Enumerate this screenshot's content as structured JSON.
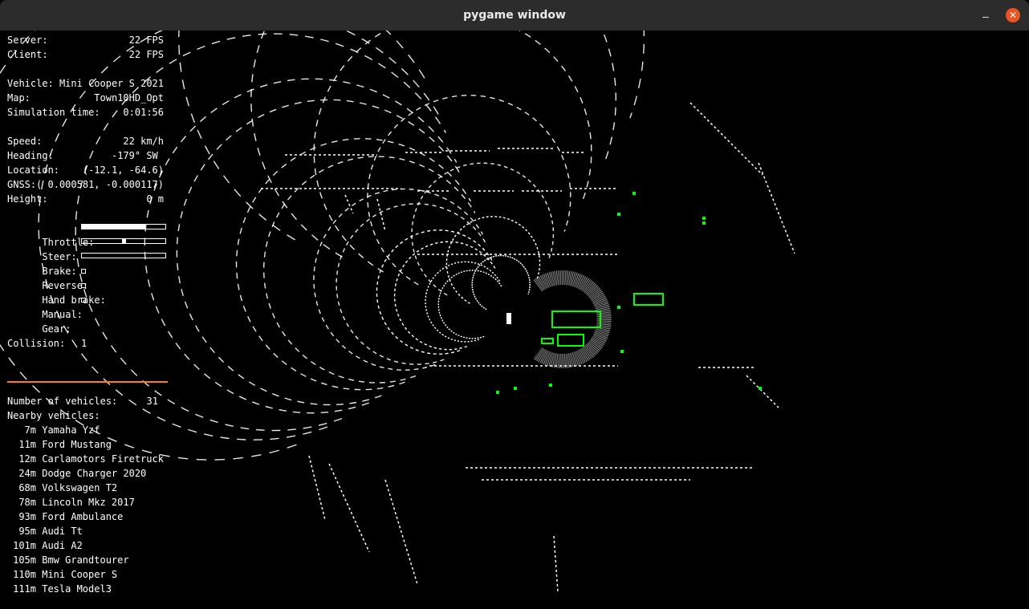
{
  "window": {
    "title": "pygame window",
    "controls": [
      "minimize-icon",
      "close-icon"
    ],
    "close_color": "#e95420"
  },
  "hud": {
    "server_label": "Server:",
    "server_value": "22 FPS",
    "client_label": "Client:",
    "client_value": "22 FPS",
    "vehicle_label": "Vehicle:",
    "vehicle_value": "Mini Cooper S 2021",
    "map_label": "Map:",
    "map_value": "Town10HD_Opt",
    "sim_time_label": "Simulation time:",
    "sim_time_value": "0:01:56",
    "speed_label": "Speed:",
    "speed_value": "22 km/h",
    "heading_label": "Heading:",
    "heading_value": "-179° SW ",
    "location_label": "Location:",
    "location_value": "(-12.1, -64.6)",
    "gnss_label": "GNSS:",
    "gnss_value": "( 0.000581, -0.000117)",
    "height_label": "Height:",
    "height_value": "0 m",
    "throttle_label": "Throttle:",
    "throttle_fraction": 0.76,
    "steer_label": "Steer:",
    "steer_value": 0.0,
    "brake_label": "Brake:",
    "brake_fraction": 0.0,
    "reverse_label": "Reverse:",
    "reverse_checked": false,
    "hand_brake_label": "Hand brake:",
    "hand_brake_checked": false,
    "manual_label": "Manual:",
    "manual_checked": false,
    "gear_label": "Gear:",
    "gear_value": "1",
    "collision_label": "Collision:",
    "collision_line_color": "#ff8000",
    "num_vehicles_label": "Number of vehicles:",
    "num_vehicles_value": "31",
    "nearby_label": "Nearby vehicles:",
    "nearby": [
      {
        "distance": "7m",
        "name": "Yamaha Yzf"
      },
      {
        "distance": "11m",
        "name": "Ford Mustang"
      },
      {
        "distance": "12m",
        "name": "Carlamotors Firetruck"
      },
      {
        "distance": "24m",
        "name": "Dodge Charger 2020"
      },
      {
        "distance": "68m",
        "name": "Volkswagen T2"
      },
      {
        "distance": "78m",
        "name": "Lincoln Mkz 2017"
      },
      {
        "distance": "93m",
        "name": "Ford Ambulance"
      },
      {
        "distance": "95m",
        "name": "Audi Tt"
      },
      {
        "distance": "101m",
        "name": "Audi A2"
      },
      {
        "distance": "105m",
        "name": "Bmw Grandtourer"
      },
      {
        "distance": "110m",
        "name": "Mini Cooper S"
      },
      {
        "distance": "111m",
        "name": "Tesla Model3"
      }
    ]
  },
  "lidar": {
    "point_color": "#ffffff",
    "bbox_color": "#00ff00"
  }
}
